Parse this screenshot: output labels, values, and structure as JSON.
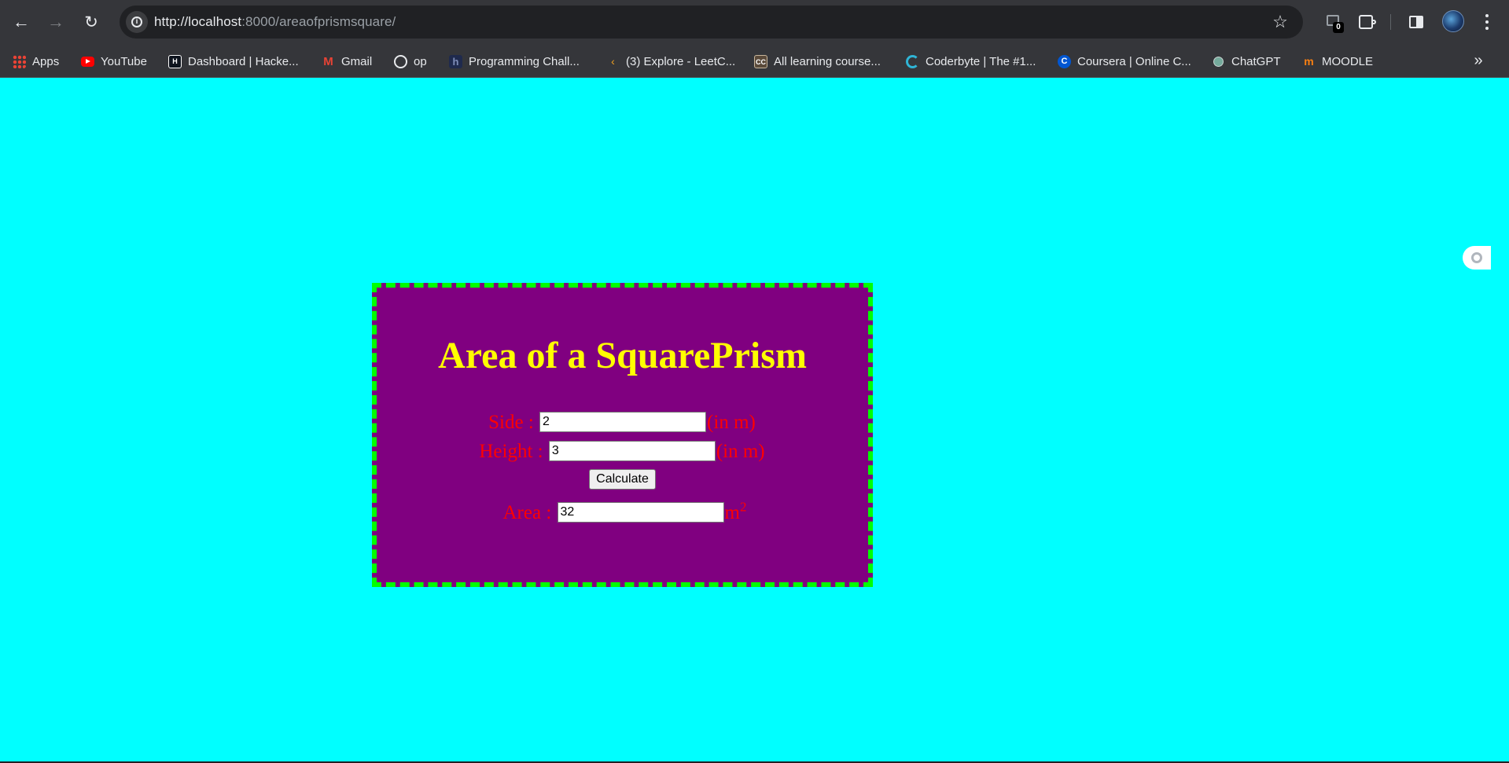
{
  "browser": {
    "url_host": "http://localhost",
    "url_rest": ":8000/areaofprismsquare/",
    "extension_badge": "0"
  },
  "bookmarks": [
    {
      "label": "Apps",
      "icon": "apps-grid-icon"
    },
    {
      "label": "YouTube",
      "icon": "youtube-icon"
    },
    {
      "label": "Dashboard | Hacke...",
      "icon": "hackerrank-icon"
    },
    {
      "label": "Gmail",
      "icon": "gmail-icon"
    },
    {
      "label": "op",
      "icon": "globe-icon"
    },
    {
      "label": "Programming Chall...",
      "icon": "h-icon"
    },
    {
      "label": "(3) Explore - LeetC...",
      "icon": "leetcode-icon"
    },
    {
      "label": "All learning course...",
      "icon": "cc-icon"
    },
    {
      "label": "Coderbyte | The #1...",
      "icon": "coderbyte-icon"
    },
    {
      "label": "Coursera | Online C...",
      "icon": "coursera-icon"
    },
    {
      "label": "ChatGPT",
      "icon": "chatgpt-icon"
    },
    {
      "label": "MOODLE",
      "icon": "moodle-icon"
    }
  ],
  "page": {
    "title": "Area of a SquarePrism",
    "side_label": "Side :",
    "side_value": "2",
    "side_unit": "(in m)",
    "height_label": "Height :",
    "height_value": "3",
    "height_unit": "(in m)",
    "calculate_label": "Calculate",
    "area_label": "Area :",
    "area_value": "32",
    "area_unit_base": "m",
    "area_unit_exp": "2"
  },
  "colors": {
    "page_bg": "#00ffff",
    "card_bg": "#800080",
    "card_border": "#00ff00",
    "title": "#ffff00",
    "label": "#ff0000"
  }
}
